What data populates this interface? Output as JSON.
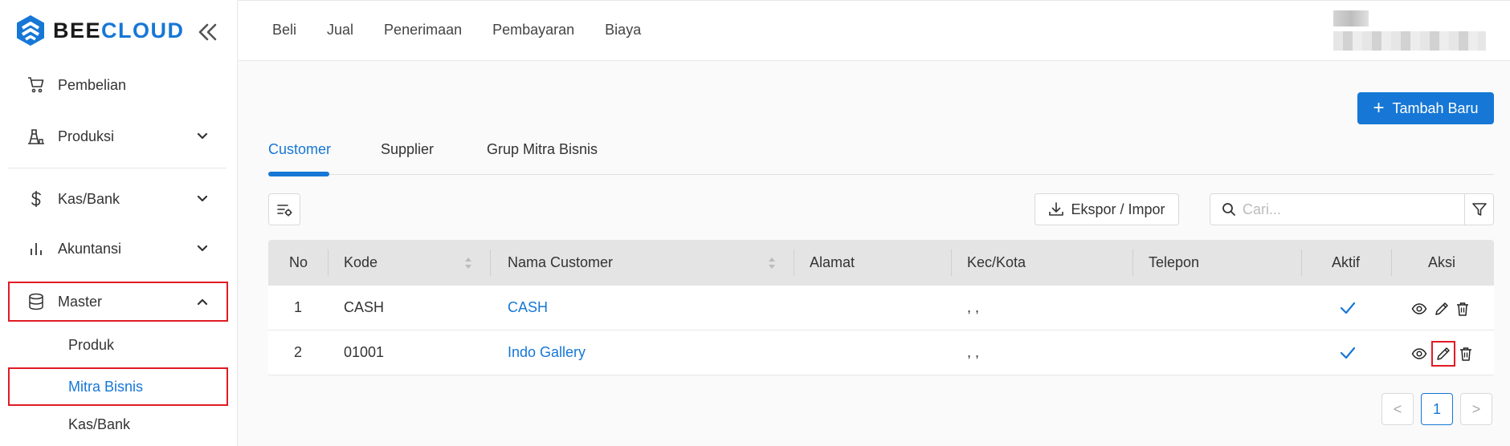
{
  "brand": {
    "part1": "BEE",
    "part2": "CLOUD",
    "accent": "#1677d6"
  },
  "sidebar": {
    "items": [
      {
        "label": "Pembelian",
        "icon": "cart-icon"
      },
      {
        "label": "Produksi",
        "icon": "factory-icon"
      },
      {
        "label": "Kas/Bank",
        "icon": "dollar-icon"
      },
      {
        "label": "Akuntansi",
        "icon": "bar-chart-icon"
      },
      {
        "label": "Master",
        "icon": "database-icon"
      }
    ],
    "master_sub": [
      "Produk",
      "Mitra Bisnis",
      "Kas/Bank"
    ]
  },
  "topnav": [
    "Beli",
    "Jual",
    "Penerimaan",
    "Pembayaran",
    "Biaya"
  ],
  "actions": {
    "add_new": "Tambah Baru",
    "export_import": "Ekspor / Impor"
  },
  "tabs": [
    "Customer",
    "Supplier",
    "Grup Mitra Bisnis"
  ],
  "search": {
    "placeholder": "Cari..."
  },
  "table": {
    "headers": [
      "No",
      "Kode",
      "Nama Customer",
      "Alamat",
      "Kec/Kota",
      "Telepon",
      "Aktif",
      "Aksi"
    ],
    "rows": [
      {
        "no": "1",
        "kode": "CASH",
        "nama": "CASH",
        "alamat": "",
        "kota": ", ,",
        "telepon": "",
        "aktif": true
      },
      {
        "no": "2",
        "kode": "01001",
        "nama": "Indo Gallery",
        "alamat": "",
        "kota": ", ,",
        "telepon": "",
        "aktif": true
      }
    ]
  },
  "pagination": {
    "current": "1",
    "prev": "<",
    "next": ">"
  }
}
